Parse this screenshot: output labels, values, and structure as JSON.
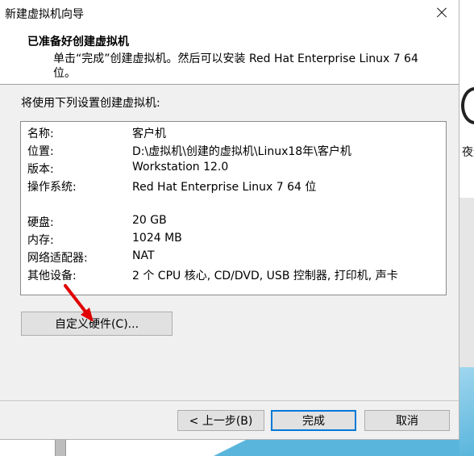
{
  "window": {
    "title": "新建虚拟机向导"
  },
  "header": {
    "title": "已准备好创建虚拟机",
    "description": "单击“完成”创建虚拟机。然后可以安装 Red Hat Enterprise Linux 7 64 位。"
  },
  "content": {
    "instruction": "将使用下列设置创建虚拟机:",
    "settings": [
      {
        "key": "名称:",
        "value": "客户机"
      },
      {
        "key": "位置:",
        "value": "D:\\虚拟机\\创建的虚拟机\\Linux18年\\客户机"
      },
      {
        "key": "版本:",
        "value": "Workstation 12.0"
      },
      {
        "key": "操作系统:",
        "value": "Red Hat Enterprise Linux 7 64 位"
      },
      {
        "key": "",
        "value": ""
      },
      {
        "key": "硬盘:",
        "value": "20 GB"
      },
      {
        "key": "内存:",
        "value": "1024 MB"
      },
      {
        "key": "网络适配器:",
        "value": "NAT"
      },
      {
        "key": "其他设备:",
        "value": "2 个 CPU 核心, CD/DVD, USB 控制器, 打印机, 声卡"
      }
    ],
    "customize_label": "自定义硬件(C)..."
  },
  "footer": {
    "back_label": "< 上一步(B)",
    "finish_label": "完成",
    "cancel_label": "取消"
  },
  "background": {
    "partial_text": "夜远"
  },
  "colors": {
    "primary_border": "#0078d7",
    "button_bg": "#e1e1e1",
    "annotation_arrow": "#e00000"
  },
  "icons": {
    "close": "close-icon",
    "arrow": "red-arrow-annotation-icon"
  }
}
